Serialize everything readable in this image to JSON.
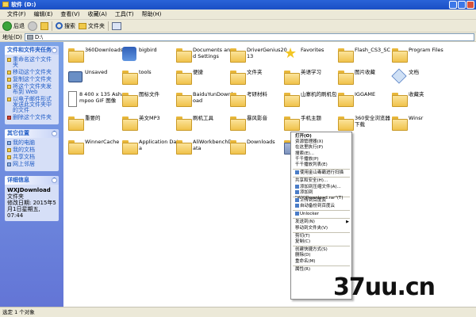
{
  "window": {
    "title": "软件 (D:)"
  },
  "menu": [
    "文件(F)",
    "编辑(E)",
    "查看(V)",
    "收藏(A)",
    "工具(T)",
    "帮助(H)"
  ],
  "toolbar": {
    "back": "后退",
    "search": "搜索",
    "folders": "文件夹"
  },
  "address": {
    "label": "地址(D)",
    "path": "D:\\"
  },
  "sidebar": {
    "file_tasks": {
      "title": "文件和文件夹任务",
      "items": [
        "重命名这个文件夹",
        "移动这个文件夹",
        "复制这个文件夹",
        "将这个文件夹发布到 Web",
        "以电子邮件形式发送此文件夹中的文件",
        "删除这个文件夹"
      ]
    },
    "other_places": {
      "title": "其它位置",
      "items": [
        "我的电脑",
        "我的文档",
        "共享文档",
        "网上邻居"
      ]
    },
    "details": {
      "title": "详细信息",
      "name": "WXJDownload",
      "type": "文件夹",
      "modified": "修改日期: 2015年5月1日星期五, 07:44"
    }
  },
  "files": [
    {
      "name": "360Downloads",
      "icon": "folder"
    },
    {
      "name": "bigbird",
      "icon": "app"
    },
    {
      "name": "Documents and Settings",
      "icon": "folder"
    },
    {
      "name": "DriverGenius2013",
      "icon": "folder"
    },
    {
      "name": "Favorites",
      "icon": "star"
    },
    {
      "name": "Flash_CS3_SC",
      "icon": "folder"
    },
    {
      "name": "Program Files",
      "icon": "folder"
    },
    {
      "name": "Unsaved",
      "icon": "camera"
    },
    {
      "name": "tools",
      "icon": "folder"
    },
    {
      "name": "便捷",
      "icon": "folder"
    },
    {
      "name": "文件夹",
      "icon": "folder"
    },
    {
      "name": "英语学习",
      "icon": "folder"
    },
    {
      "name": "图片收藏",
      "icon": "folder"
    },
    {
      "name": "文档",
      "icon": "thumb"
    },
    {
      "name": "8 400 x 135 Ashampoo GIF 图像",
      "icon": "image"
    },
    {
      "name": "图标文件",
      "icon": "folder"
    },
    {
      "name": "BaiduYunDownload",
      "icon": "folder"
    },
    {
      "name": "考研材料",
      "icon": "folder"
    },
    {
      "name": "山寨机的刷机包",
      "icon": "folder"
    },
    {
      "name": "IGGAME",
      "icon": "folder"
    },
    {
      "name": "收藏夹",
      "icon": "folder"
    },
    {
      "name": "重要的",
      "icon": "folder"
    },
    {
      "name": "英文MP3",
      "icon": "folder"
    },
    {
      "name": "刷机工具",
      "icon": "folder"
    },
    {
      "name": "暴风影音",
      "icon": "folder"
    },
    {
      "name": "手机主题",
      "icon": "folder"
    },
    {
      "name": "360安全浏览器下载",
      "icon": "folder"
    },
    {
      "name": "Winsr",
      "icon": "folder"
    },
    {
      "name": "WinnerCache",
      "icon": "folder"
    },
    {
      "name": "Application Data",
      "icon": "folder"
    },
    {
      "name": "AliWorkbenchData",
      "icon": "folder"
    },
    {
      "name": "Downloads",
      "icon": "folder"
    },
    {
      "name": "WXJDownload",
      "icon": "folder-selected"
    }
  ],
  "context_menu": [
    {
      "label": "打开(O)",
      "bold": true
    },
    {
      "label": "资源管理器(X)"
    },
    {
      "label": "在这里执行(P)"
    },
    {
      "label": "搜索(E)..."
    },
    {
      "label": "千千播放(P)"
    },
    {
      "label": "千千播放列表(E)"
    },
    {
      "sep": true
    },
    {
      "label": "使用金山毒霸进行扫描",
      "icon": true
    },
    {
      "sep": true
    },
    {
      "label": "共享和安全(H)..."
    },
    {
      "label": "添加到压缩文件(A)...",
      "icon": true
    },
    {
      "label": "添加到 \"WXJDownload.rar\"(T)",
      "icon": true
    },
    {
      "sep": true
    },
    {
      "label": "上传到百度云",
      "icon": true
    },
    {
      "label": "自动备份到百度云",
      "icon": true
    },
    {
      "sep": true
    },
    {
      "label": "Unlocker",
      "icon": true
    },
    {
      "sep": true
    },
    {
      "label": "发送到(N)",
      "arrow": true
    },
    {
      "label": "移动到文件夹(V)"
    },
    {
      "sep": true
    },
    {
      "label": "剪切(T)"
    },
    {
      "label": "复制(C)"
    },
    {
      "sep": true
    },
    {
      "label": "创建快捷方式(S)"
    },
    {
      "label": "删除(D)"
    },
    {
      "label": "重命名(M)"
    },
    {
      "sep": true
    },
    {
      "label": "属性(R)"
    }
  ],
  "status": "选定 1 个对象",
  "watermark": "37uu.cn"
}
